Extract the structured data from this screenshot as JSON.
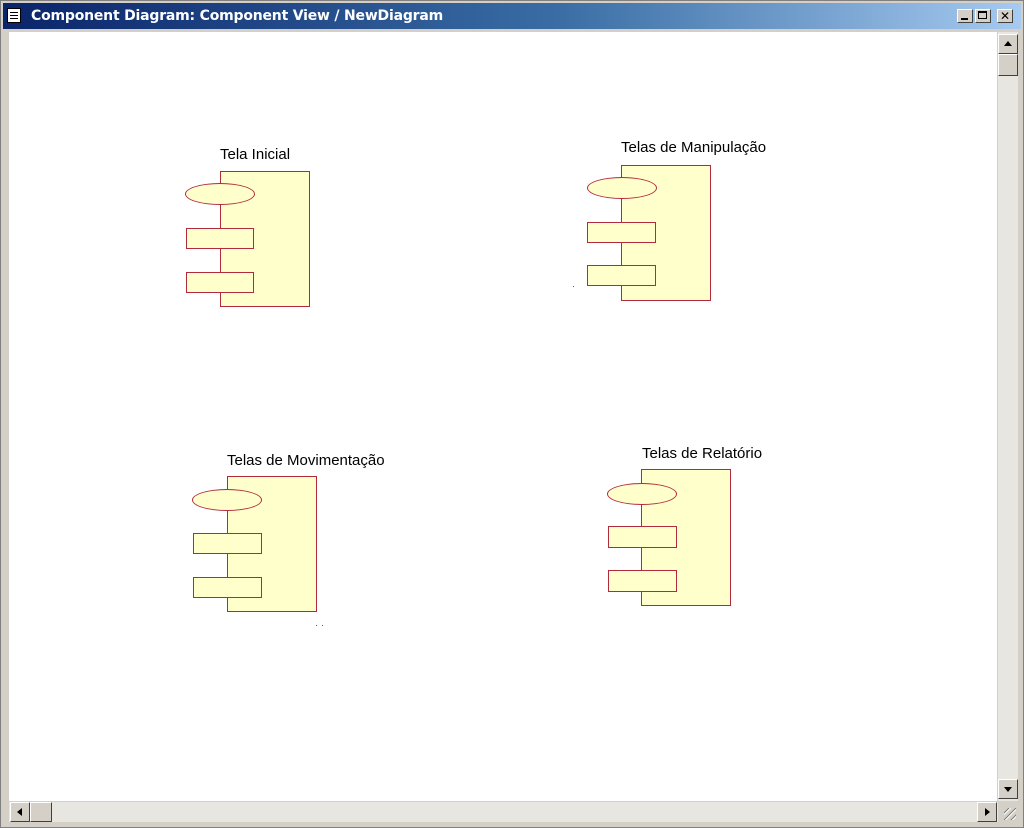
{
  "window": {
    "title": "Component Diagram: Component View / NewDiagram",
    "icon": "diagram-icon",
    "buttons": [
      "minimize",
      "maximize",
      "close"
    ]
  },
  "colors": {
    "titlebar_start": "#0a246a",
    "titlebar_end": "#a6caf0",
    "component_fill": "#ffffcc",
    "component_border": "#b22a3e",
    "canvas": "#ffffff"
  },
  "components": [
    {
      "name": "Tela Inicial"
    },
    {
      "name": "Telas de Manipulação"
    },
    {
      "name": "Telas de Movimentação"
    },
    {
      "name": "Telas de Relatório"
    }
  ],
  "scrollbars": {
    "vertical": {
      "up_icon": "arrow-up-icon",
      "down_icon": "arrow-down-icon"
    },
    "horizontal": {
      "left_icon": "arrow-left-icon",
      "right_icon": "arrow-right-icon"
    }
  }
}
